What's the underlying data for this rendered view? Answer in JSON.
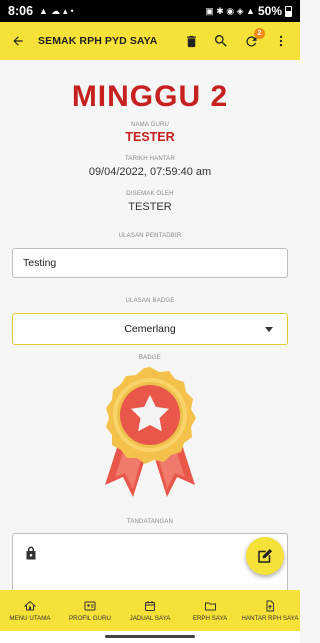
{
  "status_bar": {
    "time": "8:06",
    "battery": "50%"
  },
  "app_bar": {
    "title": "SEMAK RPH PYD SAYA",
    "notification_count": "2"
  },
  "main": {
    "week_title": "MINGGU 2",
    "teacher_label": "NAMA GURU",
    "teacher_name": "TESTER",
    "sent_label": "TARIKH HANTAR",
    "sent_date": "09/04/2022, 07:59:40 am",
    "checked_label": "DISEMAK OLEH",
    "checked_by": "TESTER",
    "admin_review_label": "ULASAN PENTADBIR",
    "admin_review_value": "Testing",
    "badge_review_label": "ULASAN BADGE",
    "badge_review_value": "Cemerlang",
    "badge_label": "BADGE",
    "signature_label": "TANDATANGAN"
  },
  "bottom_nav": [
    {
      "label": "MENU UTAMA",
      "icon": "home-icon"
    },
    {
      "label": "PROFIL GURU",
      "icon": "id-card-icon"
    },
    {
      "label": "JADUAL SAYA",
      "icon": "calendar-icon"
    },
    {
      "label": "ERPH SAYA",
      "icon": "folder-icon"
    },
    {
      "label": "HANTAR RPH SAYA",
      "icon": "upload-file-icon"
    }
  ],
  "colors": {
    "accent_yellow": "#f5e138",
    "title_red": "#c6211f",
    "badge_orange": "#f28a13"
  }
}
